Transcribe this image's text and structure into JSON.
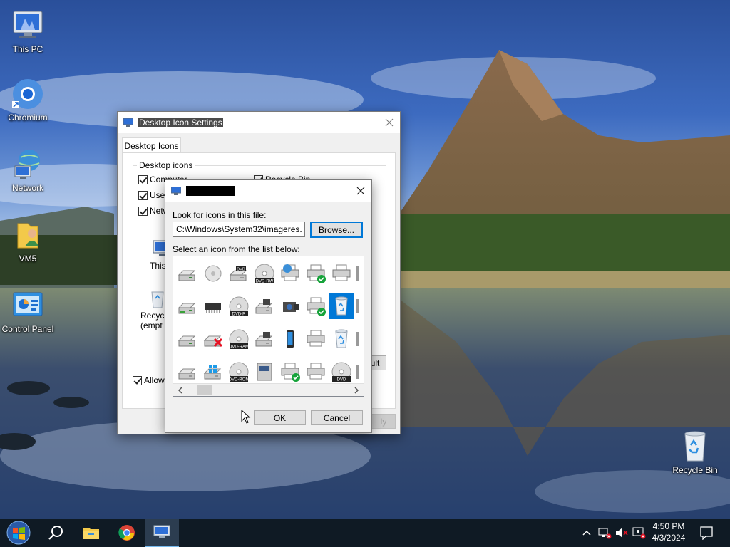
{
  "desktop": {
    "icons": [
      {
        "label": "This PC",
        "icon": "computer-icon"
      },
      {
        "label": "Chromium",
        "icon": "chromium-icon"
      },
      {
        "label": "Network",
        "icon": "network-icon"
      },
      {
        "label": "VM5",
        "icon": "user-folder-icon"
      },
      {
        "label": "Control Panel",
        "icon": "control-panel-icon"
      },
      {
        "label": "Recycle Bin",
        "icon": "recycle-bin-icon"
      }
    ]
  },
  "settings_window": {
    "title": "Desktop Icon Settings",
    "tab": "Desktop Icons",
    "group_label": "Desktop icons",
    "checkboxes": [
      {
        "label": "Computer",
        "checked": true
      },
      {
        "label": "User",
        "checked": true
      },
      {
        "label": "Netw",
        "checked": true
      },
      {
        "label": "Recycle Bin",
        "checked": true
      }
    ],
    "preview_labels": {
      "this_pc": "This P",
      "recycle": "Recycle",
      "recycle_sub": "(empt"
    },
    "restore_default": "ult",
    "allow_themes": "Allow t",
    "apply": "ly"
  },
  "change_icon_dialog": {
    "title": "",
    "look_label": "Look for icons in this file:",
    "file_path": "C:\\Windows\\System32\\imageres.dll",
    "browse": "Browse...",
    "select_label": "Select an icon from the list below:",
    "ok": "OK",
    "cancel": "Cancel",
    "icon_tags": {
      "dvd": "DVD",
      "dvdrw": "DVD-RW",
      "dvdr": "DVD-R",
      "dvdram": "DVD-RAM",
      "dvdrom": "DVD-ROM"
    }
  },
  "taskbar": {
    "time": "4:50 PM",
    "date": "4/3/2024"
  },
  "colors": {
    "accent": "#0078d7",
    "taskbar": "#0f1a24",
    "window": "#f0f0f0"
  }
}
